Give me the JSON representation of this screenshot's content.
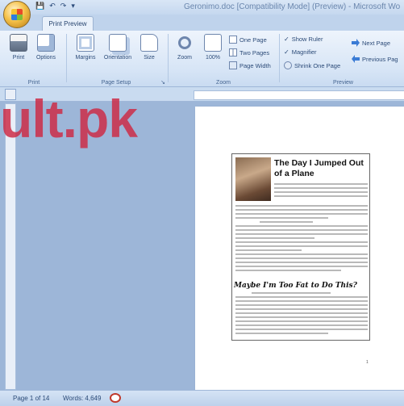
{
  "window": {
    "title": "Geronimo.doc [Compatibility Mode] (Preview) - Microsoft Wo",
    "quick_access": [
      "💾",
      "↶",
      "↷",
      "▾"
    ]
  },
  "ribbon": {
    "active_tab": "Print Preview",
    "groups": {
      "print": {
        "label": "Print",
        "print_label": "Print",
        "options_label": "Options"
      },
      "page_setup": {
        "label": "Page Setup",
        "margins_label": "Margins",
        "orientation_label": "Orientation",
        "size_label": "Size"
      },
      "zoom": {
        "label": "Zoom",
        "zoom_label": "Zoom",
        "percent_label": "100%",
        "one_page_label": "One Page",
        "two_pages_label": "Two Pages",
        "page_width_label": "Page Width"
      },
      "preview": {
        "label": "Preview",
        "show_ruler_label": "Show Ruler",
        "magnifier_label": "Magnifier",
        "shrink_one_page_label": "Shrink One Page",
        "next_page_label": "Next Page",
        "previous_page_label": "Previous Pag",
        "show_ruler_checked": true,
        "magnifier_checked": true
      }
    }
  },
  "watermark": {
    "text": "ult.pk"
  },
  "document": {
    "article_title": "The Day I Jumped Out of a Plane",
    "subheading": "Maybe I'm Too Fat to Do This?",
    "page_number": "1"
  },
  "statusbar": {
    "page_info": "Page 1 of 14",
    "words": "Words: 4,649"
  },
  "colors": {
    "ribbon_bg": "#dbe7f6",
    "workspace_bg": "#9db6d8",
    "watermark": "#cd2d48"
  }
}
